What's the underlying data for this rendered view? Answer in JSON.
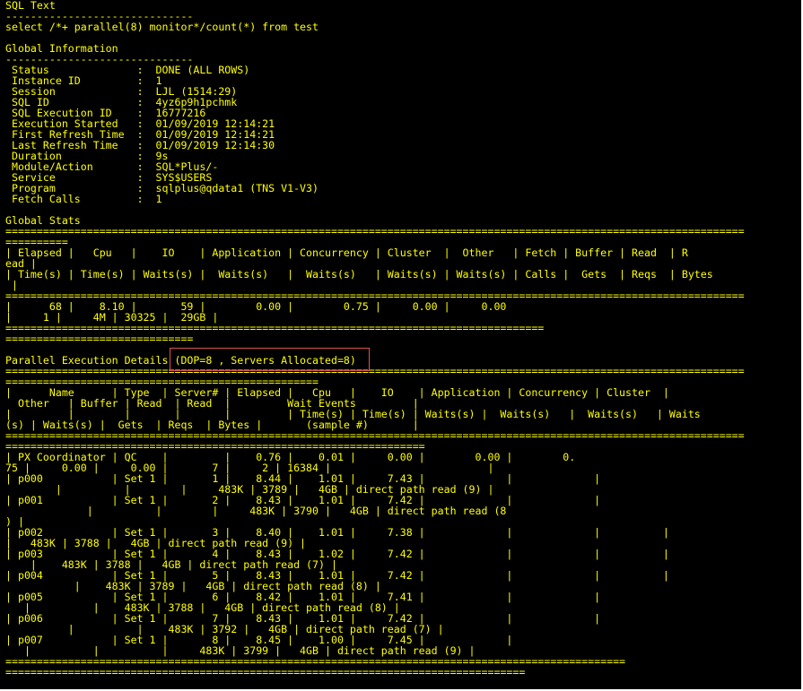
{
  "terminal": {
    "text_color": "#ffff00",
    "background_color": "#000000",
    "highlight_color": "#d9534f",
    "lines": [
      "SQL Text",
      "------------------------------",
      "select /*+ parallel(8) monitor*/count(*) from test",
      "",
      "Global Information",
      "------------------------------",
      " Status              :  DONE (ALL ROWS)",
      " Instance ID         :  1",
      " Session             :  LJL (1514:29)",
      " SQL ID              :  4yz6p9h1pchmk",
      " SQL Execution ID    :  16777216",
      " Execution Started   :  01/09/2019 12:14:21",
      " First Refresh Time  :  01/09/2019 12:14:21",
      " Last Refresh Time   :  01/09/2019 12:14:30",
      " Duration            :  9s",
      " Module/Action       :  SQL*Plus/-",
      " Service             :  SYS$USERS",
      " Program             :  sqlplus@qdata1 (TNS V1-V3)",
      " Fetch Calls         :  1",
      "",
      "Global Stats",
      "======================================================================================================================",
      "==========",
      "| Elapsed |   Cpu   |    IO    | Application | Concurrency | Cluster  |  Other   | Fetch | Buffer | Read  | R",
      "ead |",
      "| Time(s) | Time(s) | Waits(s) |  Waits(s)   |  Waits(s)   | Waits(s) | Waits(s) | Calls |  Gets  | Reqs  | Bytes",
      " |",
      "======================================================================================================================",
      "|      68 |    8.10 |       59 |        0.00 |        0.75 |     0.00 |     0.00",
      "|     1 |     4M | 30325 |  29GB |",
      "======================================================================================",
      "==============================",
      "",
      "Parallel Execution Details (DOP=8 , Servers Allocated=8)",
      "======================================================================================================================",
      "==================================================",
      "|      Name      | Type  | Server# | Elapsed |   Cpu   |    IO    | Application | Concurrency | Cluster  |",
      "  Other   | Buffer | Read  | Read  |         Wait Events         |",
      "|         |        |       |       |         | Time(s) | Time(s) | Waits(s) |  Waits(s)   |  Waits(s)   | Waits",
      "(s) | Waits(s) |  Gets  | Reqs  | Bytes |       (sample #)       |",
      "======================================================================================================================",
      "===================================================================",
      "| PX Coordinator | QC    |         |    0.76 |    0.01 |     0.00 |        0.00 |        0.",
      "75 |     0.00 |     0.00 |       7 |     2 | 16384 |                         |",
      "| p000           | Set 1 |       1 |    8.44 |    1.01 |     7.43 |             |             |",
      "        |          |        |     483K | 3789 |   4GB | direct path read (9) |",
      "| p001           | Set 1 |       2 |    8.43 |    1.01 |     7.42 |             |             |",
      "             |          |        |     483K | 3790 |   4GB | direct path read (8",
      ") |",
      "| p002           | Set 1 |       3 |    8.40 |    1.01 |     7.38 |             |             |          |",
      "|   483K | 3788 |   4GB | direct path read (9) |",
      "| p003           | Set 1 |       4 |    8.43 |    1.02 |     7.42 |             |             |          |",
      "    |    483K | 3788 |   4GB | direct path read (7) |",
      "| p004           | Set 1 |       5 |    8.43 |    1.01 |     7.42 |             |             |          |",
      "           |    483K | 3789 |   4GB | direct path read (8) |",
      "| p005           | Set 1 |       6 |    8.42 |    1.01 |     7.41 |             |             |",
      "   |          |    483K | 3788 |   4GB | direct path read (8) |",
      "| p006           | Set 1 |       7 |    8.43 |    1.01 |     7.42 |             |             |",
      "          |          |    483K | 3792 |   4GB | direct path read (7) |",
      "| p007           | Set 1 |       8 |    8.45 |    1.00 |     7.45 |             |",
      "   |          |          |     483K | 3799 |   4GB | direct path read (9) |",
      "===================================================================================================",
      "==================================================================================="
    ]
  }
}
